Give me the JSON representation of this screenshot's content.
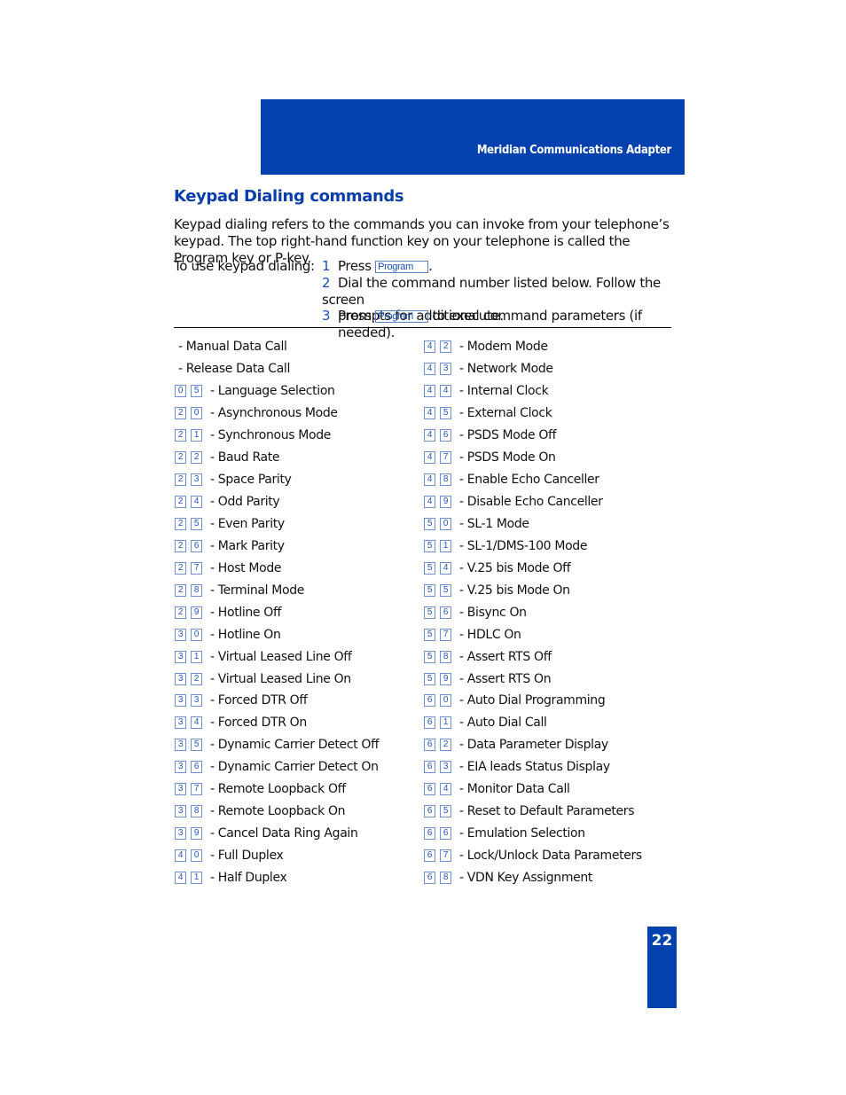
{
  "header": {
    "title": "Meridian Communications Adapter"
  },
  "section": {
    "title": "Keypad Dialing commands",
    "intro": "Keypad dialing refers to the commands you can invoke from your telephone’s keypad. The top right-hand function key on your telephone is called the Program key or P-key.",
    "steps_label": "To use keypad dialing:",
    "steps": [
      {
        "num": "1",
        "before": "Press",
        "key": "Program",
        "after": "."
      },
      {
        "num": "2",
        "line1": "Dial the command number listed below. Follow the screen",
        "line2": "prompts for additional command parameters (if needed)."
      },
      {
        "num": "3",
        "before": "Press",
        "key": "Program",
        "after": "to execute."
      }
    ]
  },
  "commands_left": [
    {
      "keys": [],
      "label": "- Manual Data Call"
    },
    {
      "keys": [],
      "label": "- Release Data Call"
    },
    {
      "keys": [
        "0",
        "5"
      ],
      "label": "- Language Selection"
    },
    {
      "keys": [
        "2",
        "0"
      ],
      "label": "- Asynchronous Mode"
    },
    {
      "keys": [
        "2",
        "1"
      ],
      "label": "- Synchronous Mode"
    },
    {
      "keys": [
        "2",
        "2"
      ],
      "label": "- Baud Rate"
    },
    {
      "keys": [
        "2",
        "3"
      ],
      "label": "- Space Parity"
    },
    {
      "keys": [
        "2",
        "4"
      ],
      "label": "- Odd Parity"
    },
    {
      "keys": [
        "2",
        "5"
      ],
      "label": "- Even Parity"
    },
    {
      "keys": [
        "2",
        "6"
      ],
      "label": "- Mark Parity"
    },
    {
      "keys": [
        "2",
        "7"
      ],
      "label": "- Host Mode"
    },
    {
      "keys": [
        "2",
        "8"
      ],
      "label": "- Terminal Mode"
    },
    {
      "keys": [
        "2",
        "9"
      ],
      "label": "- Hotline Off"
    },
    {
      "keys": [
        "3",
        "0"
      ],
      "label": "- Hotline On"
    },
    {
      "keys": [
        "3",
        "1"
      ],
      "label": "- Virtual Leased Line Off"
    },
    {
      "keys": [
        "3",
        "2"
      ],
      "label": "- Virtual Leased Line On"
    },
    {
      "keys": [
        "3",
        "3"
      ],
      "label": "- Forced DTR Off"
    },
    {
      "keys": [
        "3",
        "4"
      ],
      "label": "- Forced DTR On"
    },
    {
      "keys": [
        "3",
        "5"
      ],
      "label": "- Dynamic Carrier Detect Off"
    },
    {
      "keys": [
        "3",
        "6"
      ],
      "label": "- Dynamic Carrier Detect On"
    },
    {
      "keys": [
        "3",
        "7"
      ],
      "label": "- Remote Loopback Off"
    },
    {
      "keys": [
        "3",
        "8"
      ],
      "label": "- Remote Loopback On"
    },
    {
      "keys": [
        "3",
        "9"
      ],
      "label": "- Cancel Data Ring Again"
    },
    {
      "keys": [
        "4",
        "0"
      ],
      "label": "- Full Duplex"
    },
    {
      "keys": [
        "4",
        "1"
      ],
      "label": "- Half Duplex"
    }
  ],
  "commands_right": [
    {
      "keys": [
        "4",
        "2"
      ],
      "label": "- Modem Mode"
    },
    {
      "keys": [
        "4",
        "3"
      ],
      "label": "- Network Mode"
    },
    {
      "keys": [
        "4",
        "4"
      ],
      "label": "- Internal Clock"
    },
    {
      "keys": [
        "4",
        "5"
      ],
      "label": "- External Clock"
    },
    {
      "keys": [
        "4",
        "6"
      ],
      "label": "- PSDS Mode Off"
    },
    {
      "keys": [
        "4",
        "7"
      ],
      "label": "- PSDS Mode On"
    },
    {
      "keys": [
        "4",
        "8"
      ],
      "label": "- Enable Echo Canceller"
    },
    {
      "keys": [
        "4",
        "9"
      ],
      "label": "- Disable Echo Canceller"
    },
    {
      "keys": [
        "5",
        "0"
      ],
      "label": "- SL-1 Mode"
    },
    {
      "keys": [
        "5",
        "1"
      ],
      "label": "- SL-1/DMS-100 Mode"
    },
    {
      "keys": [
        "5",
        "4"
      ],
      "label": "- V.25 bis Mode Off"
    },
    {
      "keys": [
        "5",
        "5"
      ],
      "label": "- V.25 bis Mode On"
    },
    {
      "keys": [
        "5",
        "6"
      ],
      "label": "- Bisync On"
    },
    {
      "keys": [
        "5",
        "7"
      ],
      "label": "- HDLC On"
    },
    {
      "keys": [
        "5",
        "8"
      ],
      "label": "- Assert RTS Off"
    },
    {
      "keys": [
        "5",
        "9"
      ],
      "label": "- Assert RTS On"
    },
    {
      "keys": [
        "6",
        "0"
      ],
      "label": "- Auto Dial Programming"
    },
    {
      "keys": [
        "6",
        "1"
      ],
      "label": "- Auto Dial Call"
    },
    {
      "keys": [
        "6",
        "2"
      ],
      "label": "- Data Parameter Display"
    },
    {
      "keys": [
        "6",
        "3"
      ],
      "label": "- EIA leads Status Display"
    },
    {
      "keys": [
        "6",
        "4"
      ],
      "label": "- Monitor Data Call"
    },
    {
      "keys": [
        "6",
        "5"
      ],
      "label": "- Reset to Default Parameters"
    },
    {
      "keys": [
        "6",
        "6"
      ],
      "label": "- Emulation Selection"
    },
    {
      "keys": [
        "6",
        "7"
      ],
      "label": "- Lock/Unlock Data Parameters"
    },
    {
      "keys": [
        "6",
        "8"
      ],
      "label": "- VDN Key Assignment"
    }
  ],
  "page": {
    "number": "22"
  },
  "colors": {
    "brand_blue": "#0341ae",
    "heading_blue": "#0a3ea8",
    "key_blue": "#2455b8"
  }
}
